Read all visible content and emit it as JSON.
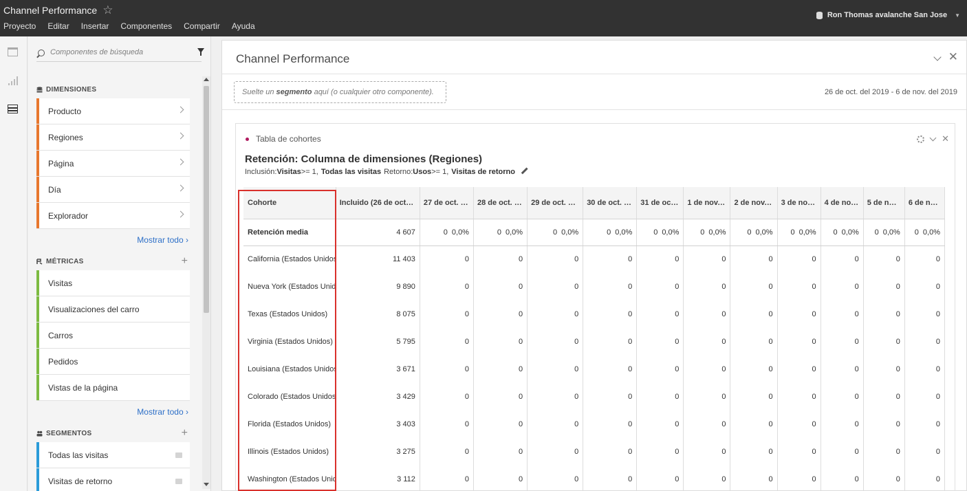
{
  "app": {
    "title": "Channel Performance",
    "menu": [
      "Proyecto",
      "Editar",
      "Insertar",
      "Componentes",
      "Compartir",
      "Ayuda"
    ],
    "user": "Ron Thomas avalanche San Jose"
  },
  "left_rail": {
    "icons": [
      "panels-icon",
      "visualizations-icon",
      "components-icon"
    ]
  },
  "components": {
    "search_placeholder": "Componentes de búsqueda",
    "dimensions": {
      "title": "DIMENSIONES",
      "items": [
        "Producto",
        "Regiones",
        "Página",
        "Día",
        "Explorador"
      ],
      "show_all": "Mostrar todo",
      "color": "#e8772e"
    },
    "metrics": {
      "title": "MÉTRICAS",
      "items": [
        "Visitas",
        "Visualizaciones del carro",
        "Carros",
        "Pedidos",
        "Vistas de la página"
      ],
      "show_all": "Mostrar todo",
      "color": "#7dbb42"
    },
    "segments": {
      "title": "SEGMENTOS",
      "items": [
        "Todas las visitas",
        "Visitas de retorno"
      ],
      "color": "#2b9bd8"
    }
  },
  "workspace": {
    "project_title": "Channel Performance",
    "dropzone": {
      "pre": "Suelte un ",
      "bold": "segmento",
      "post": " aquí (o cualquier otro componente)."
    },
    "date_range": "26 de oct. del 2019 - 6 de nov. del 2019"
  },
  "panel": {
    "header": "Tabla de cohortes",
    "title": "Retención: Columna de dimensiones (Regiones)",
    "subtitle": {
      "inc_label": "Inclusión: ",
      "inc_metric": "Visitas",
      "inc_cond": " >= 1, ",
      "inc_segment": "Todas las visitas",
      "ret_label": " Retorno: ",
      "ret_metric": "Usos",
      "ret_cond": " >= 1, ",
      "ret_segment": "Visitas de retorno"
    },
    "table": {
      "columns": [
        "Cohorte",
        "Incluido (26 de oct. d...",
        "27 de oct. de...",
        "28 de oct. d...",
        "29 de oct. de...",
        "30 de oct. d...",
        "31 de oct. ...",
        "1 de nov. d...",
        "2 de nov. ...",
        "3 de nov....",
        "4 de nov. ...",
        "5 de nov....",
        "6 de nov..."
      ],
      "average": {
        "label": "Retención media",
        "included": "4 607",
        "cells": [
          "0",
          "0,0%"
        ]
      },
      "rows": [
        {
          "label": "California (Estados Unidos)",
          "included": "11 403"
        },
        {
          "label": "Nueva York (Estados Unidos)",
          "included": "9 890"
        },
        {
          "label": "Texas (Estados Unidos)",
          "included": "8 075"
        },
        {
          "label": "Virginia (Estados Unidos)",
          "included": "5 795"
        },
        {
          "label": "Louisiana (Estados Unidos)",
          "included": "3 671"
        },
        {
          "label": "Colorado (Estados Unidos)",
          "included": "3 429"
        },
        {
          "label": "Florida (Estados Unidos)",
          "included": "3 403"
        },
        {
          "label": "Illinois (Estados Unidos)",
          "included": "3 275"
        },
        {
          "label": "Washington (Estados Unidos)",
          "included": "3 112"
        }
      ],
      "cell_value": "0"
    }
  },
  "highlight_color": "#d9302b"
}
